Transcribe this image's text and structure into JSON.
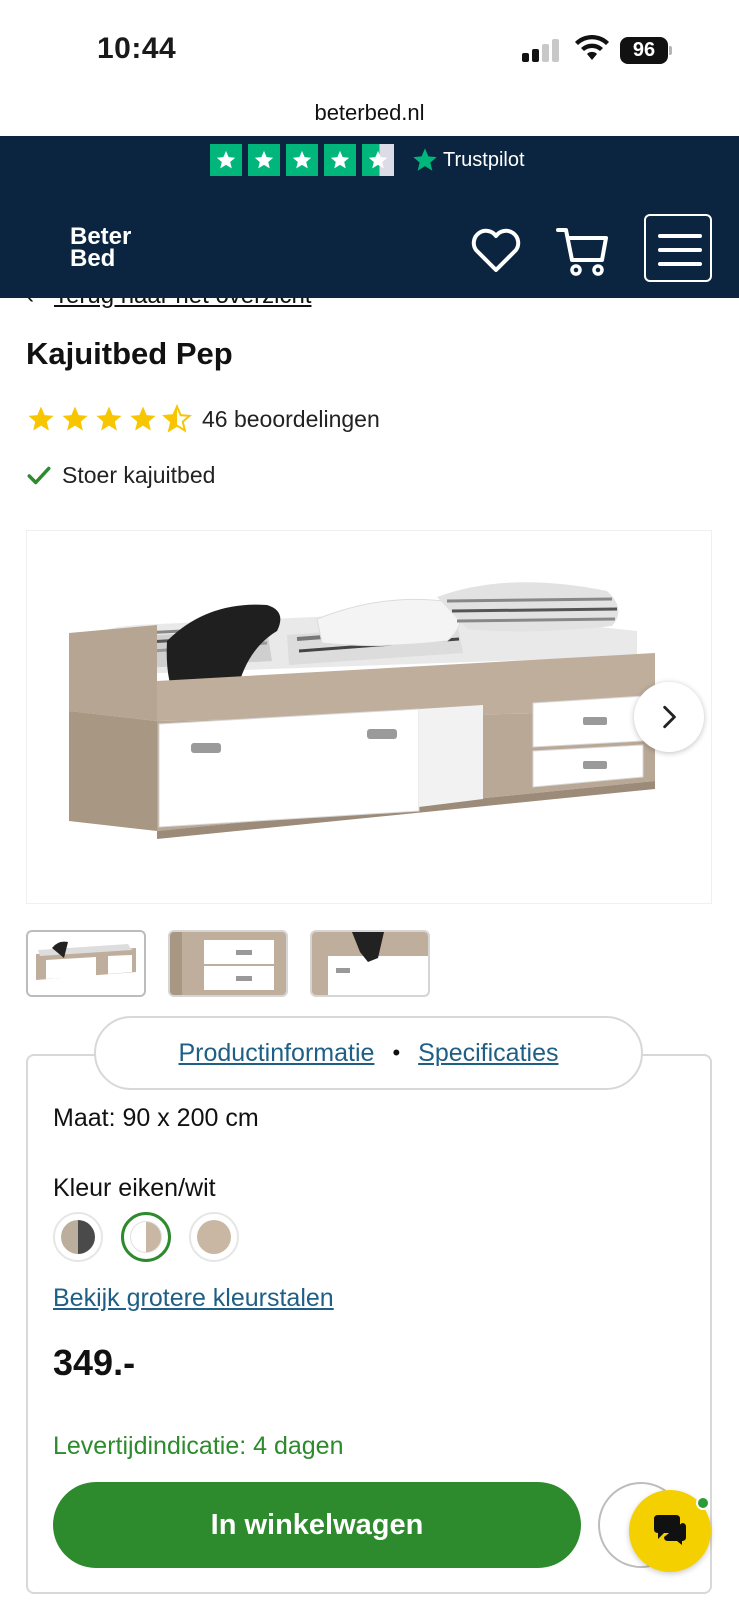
{
  "status_bar": {
    "time": "10:44",
    "battery": "96"
  },
  "browser": {
    "url": "beterbed.nl"
  },
  "trustpilot": {
    "brand": "Trustpilot",
    "rating_stars": 4.5
  },
  "header": {
    "logo_line1": "Beter",
    "logo_line2": "Bed"
  },
  "product": {
    "back_link": "Terug naar het overzicht",
    "title": "Kajuitbed Pep",
    "rating_stars": 4.5,
    "reviews": "46 beoordelingen",
    "usp": "Stoer kajuitbed"
  },
  "tabs": {
    "productinfo": "Productinformatie",
    "separator": "•",
    "specs": "Specificaties"
  },
  "options": {
    "size": "Maat: 90 x 200 cm",
    "color": "Kleur eiken/wit",
    "color_link": "Bekijk grotere kleurstalen"
  },
  "price": "349.-",
  "delivery": "Levertijdindicatie: 4 dagen",
  "cart_button": "In winkelwagen",
  "colors": {
    "brand_navy": "#0b2540",
    "accent_green": "#2d8a2d",
    "trustpilot_green": "#00b67a",
    "star_yellow": "#f7c600",
    "link_blue": "#1f5f86",
    "chat_yellow": "#f5d000"
  }
}
